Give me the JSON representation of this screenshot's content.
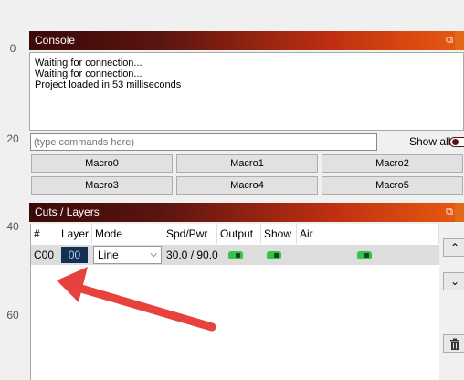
{
  "ruler": {
    "ticks": [
      "0",
      "20",
      "40",
      "60"
    ]
  },
  "console": {
    "title": "Console",
    "float_icon": "⧉",
    "lines": [
      "Waiting for connection...",
      "Waiting for connection...",
      "Project loaded in 53 milliseconds"
    ],
    "input_placeholder": "(type commands here)",
    "show_all_label": "Show all",
    "macros": [
      "Macro0",
      "Macro1",
      "Macro2",
      "Macro3",
      "Macro4",
      "Macro5"
    ]
  },
  "cuts": {
    "title": "Cuts / Layers",
    "float_icon": "⧉",
    "columns": [
      "#",
      "Layer",
      "Mode",
      "Spd/Pwr",
      "Output",
      "Show",
      "Air"
    ],
    "row": {
      "id": "C00",
      "layer": "00",
      "mode": "Line",
      "spd_pwr": "30.0 / 90.0"
    },
    "side_buttons": {
      "up_icon": "chevron-up-icon",
      "down_icon": "chevron-down-icon",
      "delete_icon": "trash-icon"
    }
  },
  "colors": {
    "title_dark": "#3a0a08",
    "title_light": "#e85a10",
    "layer_bg": "#17304f",
    "switch_on": "#36c24a",
    "annotation_arrow": "#e8423f"
  }
}
